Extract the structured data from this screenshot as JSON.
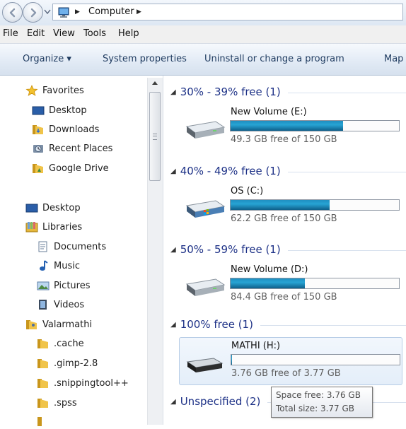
{
  "address": {
    "path": [
      "Computer"
    ],
    "back_label": "Back",
    "forward_label": "Forward"
  },
  "menu": [
    "File",
    "Edit",
    "View",
    "Tools",
    "Help"
  ],
  "toolbar": {
    "organize": "Organize ▾",
    "system_properties": "System properties",
    "uninstall": "Uninstall or change a program",
    "map": "Map"
  },
  "nav": {
    "favorites": {
      "label": "Favorites",
      "items": [
        "Desktop",
        "Downloads",
        "Recent Places",
        "Google Drive"
      ]
    },
    "desktop": "Desktop",
    "libraries": {
      "label": "Libraries",
      "items": [
        "Documents",
        "Music",
        "Pictures",
        "Videos"
      ]
    },
    "user": {
      "label": "Valarmathi",
      "items": [
        ".cache",
        ".gimp-2.8",
        ".snippingtool++",
        ".spss"
      ]
    }
  },
  "groups": [
    {
      "header": "30% - 39% free (1)",
      "drive": {
        "name": "New Volume (E:)",
        "free": "49.3 GB free of 150 GB",
        "used_fraction": 0.67
      }
    },
    {
      "header": "40% - 49% free (1)",
      "drive": {
        "name": "OS (C:)",
        "free": "62.2 GB free of 150 GB",
        "used_fraction": 0.59
      }
    },
    {
      "header": "50% - 59% free (1)",
      "drive": {
        "name": "New Volume (D:)",
        "free": "84.4 GB free of 150 GB",
        "used_fraction": 0.44
      }
    },
    {
      "header": "100% free (1)",
      "drive": {
        "name": "MATHI (H:)",
        "free": "3.76 GB free of 3.77 GB",
        "used_fraction": 0.003
      }
    },
    {
      "header": "Unspecified (2)"
    }
  ],
  "tooltip": {
    "space_free": "Space free: 3.76 GB",
    "total_size": "Total size: 3.77 GB"
  }
}
